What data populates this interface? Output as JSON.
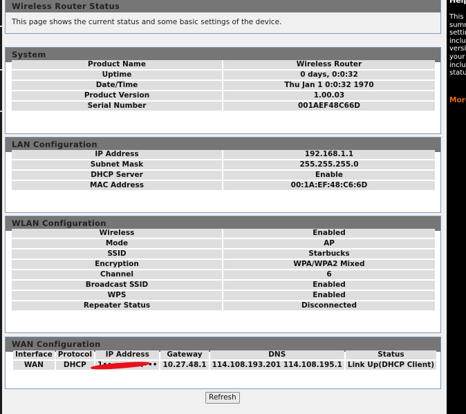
{
  "status": {
    "title": "Wireless Router Status",
    "description": "This page shows the current status and some basic settings of the device."
  },
  "system": {
    "title": "System",
    "rows": [
      {
        "label": "Product Name",
        "value": "Wireless Router"
      },
      {
        "label": "Uptime",
        "value": "0 days, 0:0:32"
      },
      {
        "label": "Date/Time",
        "value": "Thu Jan 1 0:0:32 1970"
      },
      {
        "label": "Product Version",
        "value": "1.00.03"
      },
      {
        "label": "Serial Number",
        "value": "001AEF48C66D"
      }
    ]
  },
  "lan": {
    "title": "LAN Configuration",
    "rows": [
      {
        "label": "IP Address",
        "value": "192.168.1.1"
      },
      {
        "label": "Subnet Mask",
        "value": "255.255.255.0"
      },
      {
        "label": "DHCP Server",
        "value": "Enable"
      },
      {
        "label": "MAC Address",
        "value": "00:1A:EF:48:C6:6D"
      }
    ]
  },
  "wlan": {
    "title": "WLAN Configuration",
    "rows": [
      {
        "label": "Wireless",
        "value": "Enabled"
      },
      {
        "label": "Mode",
        "value": "AP"
      },
      {
        "label": "SSID",
        "value": "Starbucks"
      },
      {
        "label": "Encryption",
        "value": "WPA/WPA2 Mixed"
      },
      {
        "label": "Channel",
        "value": "6"
      },
      {
        "label": "Broadcast SSID",
        "value": "Enabled"
      },
      {
        "label": "WPS",
        "value": "Enabled"
      },
      {
        "label": "Repeater Status",
        "value": "Disconnected"
      }
    ]
  },
  "wan": {
    "title": "WAN Configuration",
    "headers": [
      "Interface",
      "Protocol",
      "IP Address",
      "Gateway",
      "DNS",
      "Status"
    ],
    "row": {
      "interface": "WAN",
      "protocol": "DHCP",
      "ip_address": "1••.•••.••.•••",
      "gateway": "10.27.48.1",
      "dns": "114.108.193.201 114.108.195.1",
      "status": "Link Up(DHCP Client)"
    }
  },
  "actions": {
    "refresh_label": "Refresh"
  },
  "help": {
    "title": "Helpful Hints..",
    "text": "This page displays a summary of the settings of your router, including firmware version, a summary of your Internet settings including connection status.",
    "more_label": "More..."
  },
  "colors": {
    "header_bg": "#767676",
    "border": "#7d9bbf",
    "row_bg": "#dedede",
    "help_bg": "#000000",
    "more_link": "#e06a1f",
    "redaction": "#e8101a"
  }
}
